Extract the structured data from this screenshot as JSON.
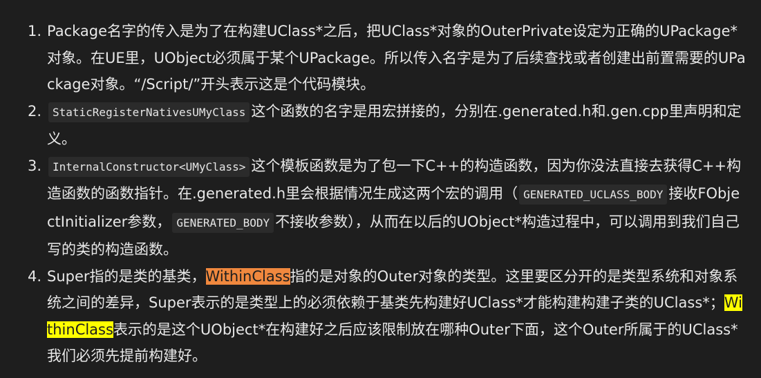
{
  "items": [
    {
      "num": "1.",
      "text": "Package名字的传入是为了在构建UClass*之后，把UClass*对象的OuterPrivate设定为正确的UPackage*对象。在UE里，UObject必须属于某个UPackage。所以传入名字是为了后续查找或者创建出前置需要的UPackage对象。“/Script/”开头表示这是个代码模块。"
    },
    {
      "num": "2.",
      "code": "StaticRegisterNativesUMyClass",
      "text": "这个函数的名字是用宏拼接的，分别在.generated.h和.gen.cpp里声明和定义。"
    },
    {
      "num": "3.",
      "code": "InternalConstructor<UMyClass>",
      "text_a": "这个模板函数是为了包一下C++的构造函数，因为你没法直接去获得C++构造函数的函数指针。在.generated.h里会根据情况生成这两个宏的调用（",
      "code_b": "GENERATED_UCLASS_BODY",
      "text_b": "接收FObjectInitializer参数，",
      "code_c": "GENERATED_BODY",
      "text_c": "不接收参数），从而在以后的UObject*构造过程中，可以调用到我们自己写的类的构造函数。"
    },
    {
      "num": "4.",
      "text_a": "Super指的是类的基类，",
      "hl_a": "WithinClass",
      "text_b": "指的是对象的Outer对象的类型。这里要区分开的是类型系统和对象系统之间的差异，Super表示的是类型上的必须依赖于基类先构建好UClass*才能构建构建子类的UClass*；",
      "hl_b": "WithinClass",
      "text_c": "表示的是这个UObject*在构建好之后应该限制放在哪种Outer下面，这个Outer所属于的UClass*我们必须先提前构建好。"
    }
  ],
  "colors": {
    "background": "#1e1e1e",
    "text": "#e8e8e8",
    "code_bg": "#2b2b2b",
    "highlight_orange": "#f0883e",
    "highlight_yellow": "#ffff00"
  }
}
